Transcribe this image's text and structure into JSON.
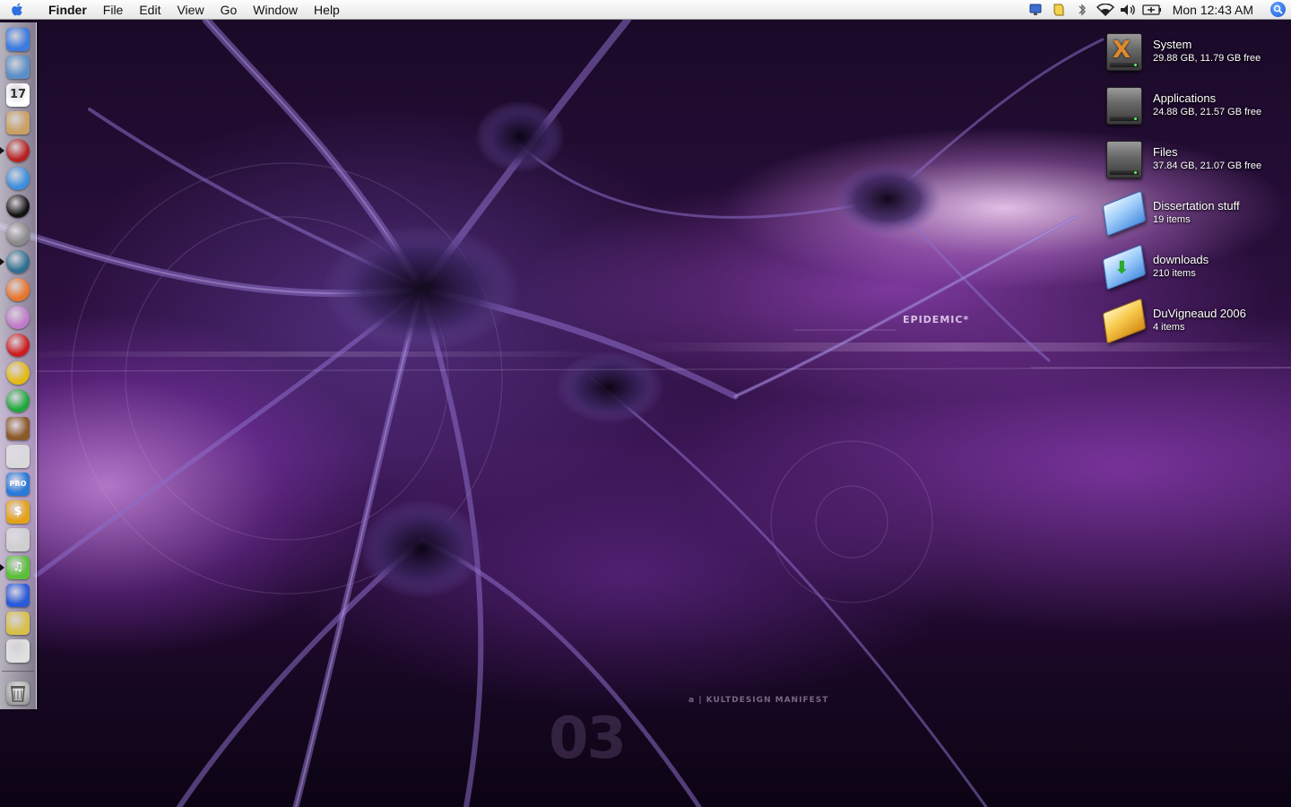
{
  "menubar": {
    "app_name": "Finder",
    "menus": [
      "File",
      "Edit",
      "View",
      "Go",
      "Window",
      "Help"
    ],
    "clock": "Mon 12:43 AM",
    "status_icons": [
      "display-icon",
      "script-icon",
      "bluetooth-icon",
      "wifi-icon",
      "volume-icon",
      "battery-icon"
    ]
  },
  "wallpaper": {
    "title_text": "EPIDEMIC*",
    "credit_text": "a | KULTDESIGN MANIFEST",
    "number_text": "03"
  },
  "dock": {
    "items": [
      {
        "id": "finder",
        "icon": "finder-icon",
        "color": "#3d7be0",
        "running": false
      },
      {
        "id": "preview",
        "icon": "preview-icon",
        "color": "#5b8fc7",
        "running": false
      },
      {
        "id": "ical",
        "icon": "calendar-icon",
        "color": "#ffffff",
        "label": "17",
        "running": false
      },
      {
        "id": "address-book",
        "icon": "address-book-icon",
        "color": "#c9a064",
        "running": false
      },
      {
        "id": "app-red",
        "icon": "red-disc-icon",
        "color": "#b82121",
        "running": true
      },
      {
        "id": "safari",
        "icon": "safari-icon",
        "color": "#3a8ee0",
        "running": false
      },
      {
        "id": "black-orb",
        "icon": "black-orb-icon",
        "color": "#141414",
        "running": false
      },
      {
        "id": "gray-orb",
        "icon": "gray-orb-icon",
        "color": "#8a8a8a",
        "running": false
      },
      {
        "id": "network-app",
        "icon": "globe-icon",
        "color": "#2f6f8f",
        "running": true
      },
      {
        "id": "firefox",
        "icon": "firefox-icon",
        "color": "#e8742a",
        "running": false
      },
      {
        "id": "flower-app",
        "icon": "flower-icon",
        "color": "#c07ac8",
        "running": false
      },
      {
        "id": "flash",
        "icon": "flash-icon",
        "color": "#cc1d1d",
        "running": false
      },
      {
        "id": "yellow-app",
        "icon": "yellow-disc-icon",
        "color": "#e3b913",
        "running": false
      },
      {
        "id": "green-app",
        "icon": "green-disc-icon",
        "color": "#1ea83a",
        "running": false
      },
      {
        "id": "library-app",
        "icon": "books-icon",
        "color": "#8a5a2a",
        "running": false
      },
      {
        "id": "textedit",
        "icon": "document-icon",
        "color": "#d9d9d9",
        "running": false
      },
      {
        "id": "pro-app",
        "icon": "pro-icon",
        "color": "#2a7ad8",
        "label": "PRO",
        "running": false
      },
      {
        "id": "money-app",
        "icon": "dollar-icon",
        "color": "#e3a21a",
        "label": "$",
        "running": false
      },
      {
        "id": "printer-app",
        "icon": "printer-icon",
        "color": "#cfcfcf",
        "running": false
      },
      {
        "id": "itunes",
        "icon": "music-note-icon",
        "color": "#5bbf3a",
        "label": "♫",
        "running": true
      },
      {
        "id": "imovie",
        "icon": "clapper-icon",
        "color": "#2a5ad8",
        "running": false
      },
      {
        "id": "eye-app",
        "icon": "eye-icon",
        "color": "#d8c04a",
        "running": false
      },
      {
        "id": "apple-app",
        "icon": "apple-icon",
        "color": "#e0e0e0",
        "running": false
      }
    ],
    "trash": {
      "icon": "trash-icon"
    }
  },
  "desktop": {
    "items": [
      {
        "name": "System",
        "info": "29.88 GB, 11.79 GB free",
        "kind": "drive-x"
      },
      {
        "name": "Applications",
        "info": "24.88 GB, 21.57 GB free",
        "kind": "drive"
      },
      {
        "name": "Files",
        "info": "37.84 GB, 21.07 GB free",
        "kind": "drive"
      },
      {
        "name": "Dissertation stuff",
        "info": "19 items",
        "kind": "folder-blue"
      },
      {
        "name": "downloads",
        "info": "210 items",
        "kind": "folder-download"
      },
      {
        "name": "DuVigneaud 2006",
        "info": "4 items",
        "kind": "folder-gold"
      }
    ]
  }
}
